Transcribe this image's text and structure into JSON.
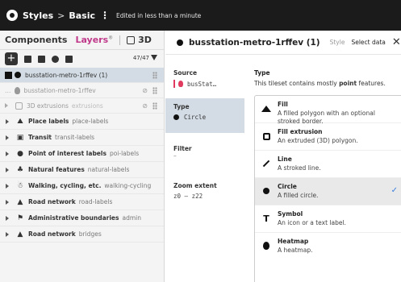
{
  "topbar": {
    "styles_label": "Styles",
    "separator": ">",
    "basic_label": "Basic",
    "kebab": "⋮",
    "edited_text": "Edited in less than a minute"
  },
  "left_panel": {
    "tabs": {
      "components": "Components",
      "layers": "Layers",
      "layers_badge": "®",
      "three_d": "3D"
    },
    "toolbar": {
      "add": "+",
      "count": "47/47"
    },
    "layers": [
      {
        "name": "busstation-metro-1rffev (1)",
        "selected": true
      },
      {
        "name": "busstation-metro-1rffev",
        "hidden": true
      },
      {
        "name": "3D extrusions",
        "id": "extrusions",
        "hidden": true
      }
    ],
    "groups": [
      {
        "icon": "⛰",
        "name": "Place labels",
        "id": "place-labels"
      },
      {
        "icon": "▣",
        "name": "Transit",
        "id": "transit-labels"
      },
      {
        "icon": "●",
        "name": "Point of interest labels",
        "id": "poi-labels"
      },
      {
        "icon": "♣",
        "name": "Natural features",
        "id": "natural-labels"
      },
      {
        "icon": "☃",
        "name": "Walking, cycling, etc.",
        "id": "walking-cycling"
      },
      {
        "icon": "▲",
        "name": "Road network",
        "id": "road-labels"
      },
      {
        "icon": "⚑",
        "name": "Administrative boundaries",
        "id": "admin"
      },
      {
        "icon": "▲",
        "name": "Road network",
        "id": "bridges"
      }
    ]
  },
  "right_panel": {
    "title": "busstation-metro-1rffev (1)",
    "tab_style": "Style",
    "tab_select_data": "Select data",
    "close": "✕",
    "sidebar": {
      "source_label": "Source",
      "source_value": "busStat…",
      "type_label": "Type",
      "type_value": "Circle",
      "filter_label": "Filter",
      "filter_value": "–",
      "zoom_label": "Zoom extent",
      "zoom_value": "z0 – z22"
    },
    "main": {
      "type_label": "Type",
      "desc_pre": "This tileset contains mostly ",
      "desc_bold": "point",
      "desc_post": " features."
    },
    "options": [
      {
        "icon": "fill-icon",
        "name": "Fill",
        "desc": "A filled polygon with an optional stroked border."
      },
      {
        "icon": "fill-extrusion-icon",
        "name": "Fill extrusion",
        "desc": "An extruded (3D) polygon."
      },
      {
        "icon": "line-icon",
        "name": "Line",
        "desc": "A stroked line."
      },
      {
        "icon": "circle-icon",
        "name": "Circle",
        "desc": "A filled circle.",
        "selected": true
      },
      {
        "icon": "symbol-icon",
        "name": "Symbol",
        "desc": "An icon or a text label."
      },
      {
        "icon": "heatmap-icon",
        "name": "Heatmap",
        "desc": "A heatmap."
      }
    ],
    "check": "✓",
    "symbol_glyph": "T"
  }
}
